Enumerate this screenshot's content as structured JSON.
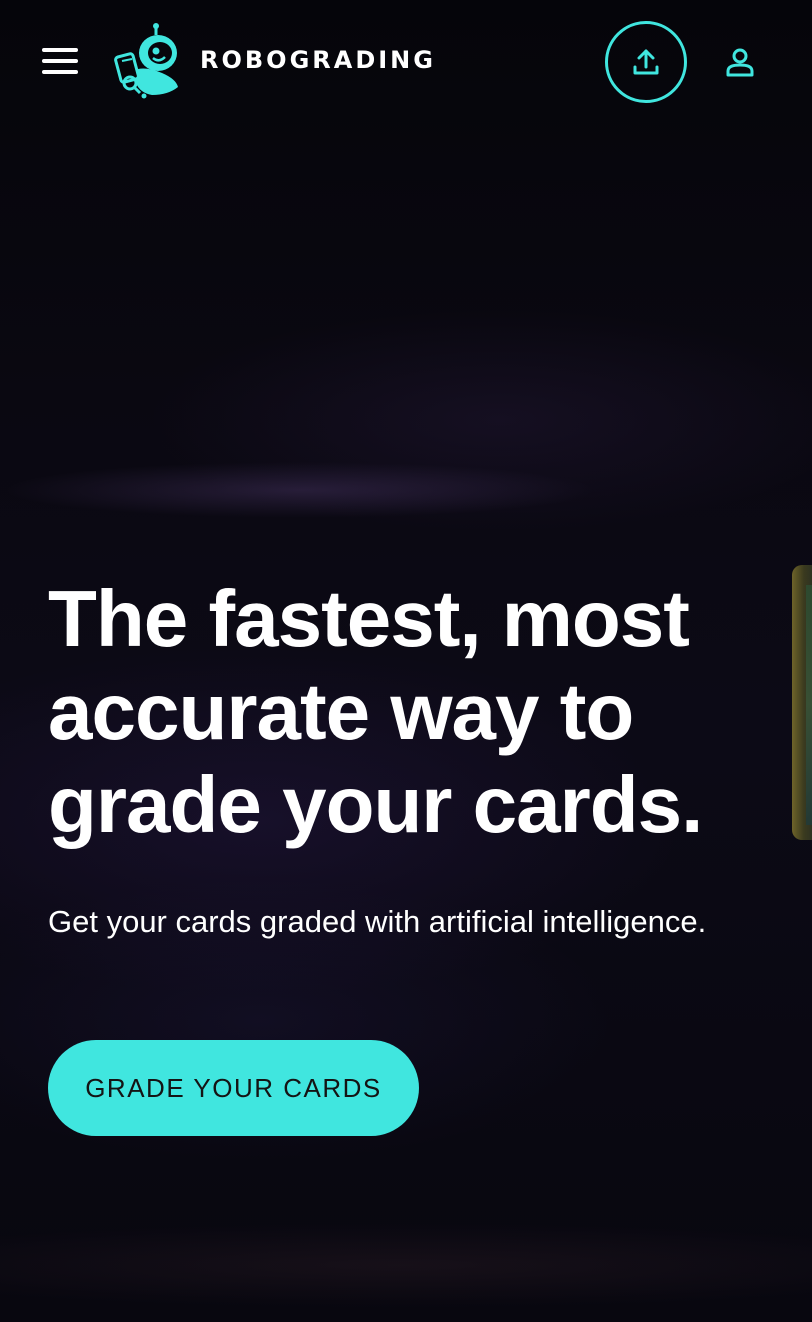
{
  "header": {
    "brand_name": "ROBOGRADING",
    "menu_icon": "hamburger-menu-icon",
    "upload_icon": "upload-icon",
    "account_icon": "user-account-icon"
  },
  "hero": {
    "title": "The fastest, most accurate way to grade your cards.",
    "subtitle": "Get your cards graded with artificial intelligence.",
    "cta_label": "GRADE YOUR CARDS"
  },
  "colors": {
    "accent": "#40e6df",
    "background": "#07060c",
    "text": "#ffffff",
    "cta_text": "#141414"
  }
}
